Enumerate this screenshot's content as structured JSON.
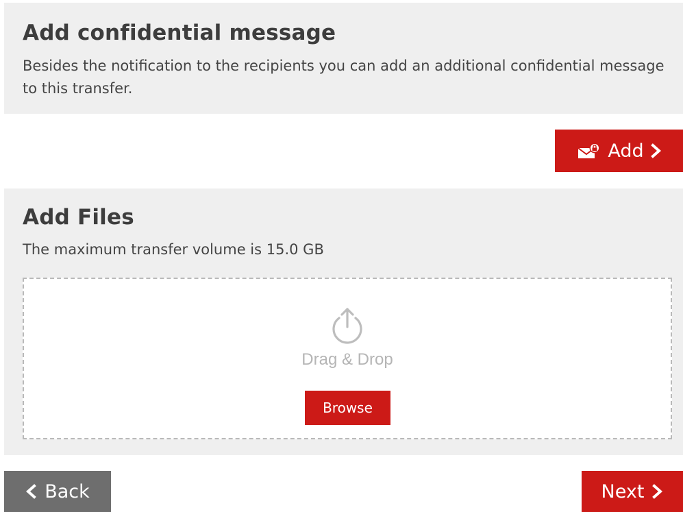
{
  "confidential": {
    "title": "Add confidential message",
    "description": "Besides the notification to the recipients you can add an additional confidential message to this transfer.",
    "add_label": "Add"
  },
  "files": {
    "title": "Add Files",
    "max_volume": "The maximum transfer volume is 15.0 GB",
    "drag_drop": "Drag & Drop",
    "browse_label": "Browse"
  },
  "nav": {
    "back_label": "Back",
    "next_label": "Next"
  },
  "icons": {
    "add_button": "envelope-lock-icon",
    "add_chevron": "chevron-right-icon",
    "upload": "upload-icon",
    "back_chevron": "chevron-left-icon",
    "next_chevron": "chevron-right-icon"
  },
  "colors": {
    "accent": "#cc1a17",
    "secondary": "#6e6e6e",
    "panel_bg": "#efefef"
  }
}
